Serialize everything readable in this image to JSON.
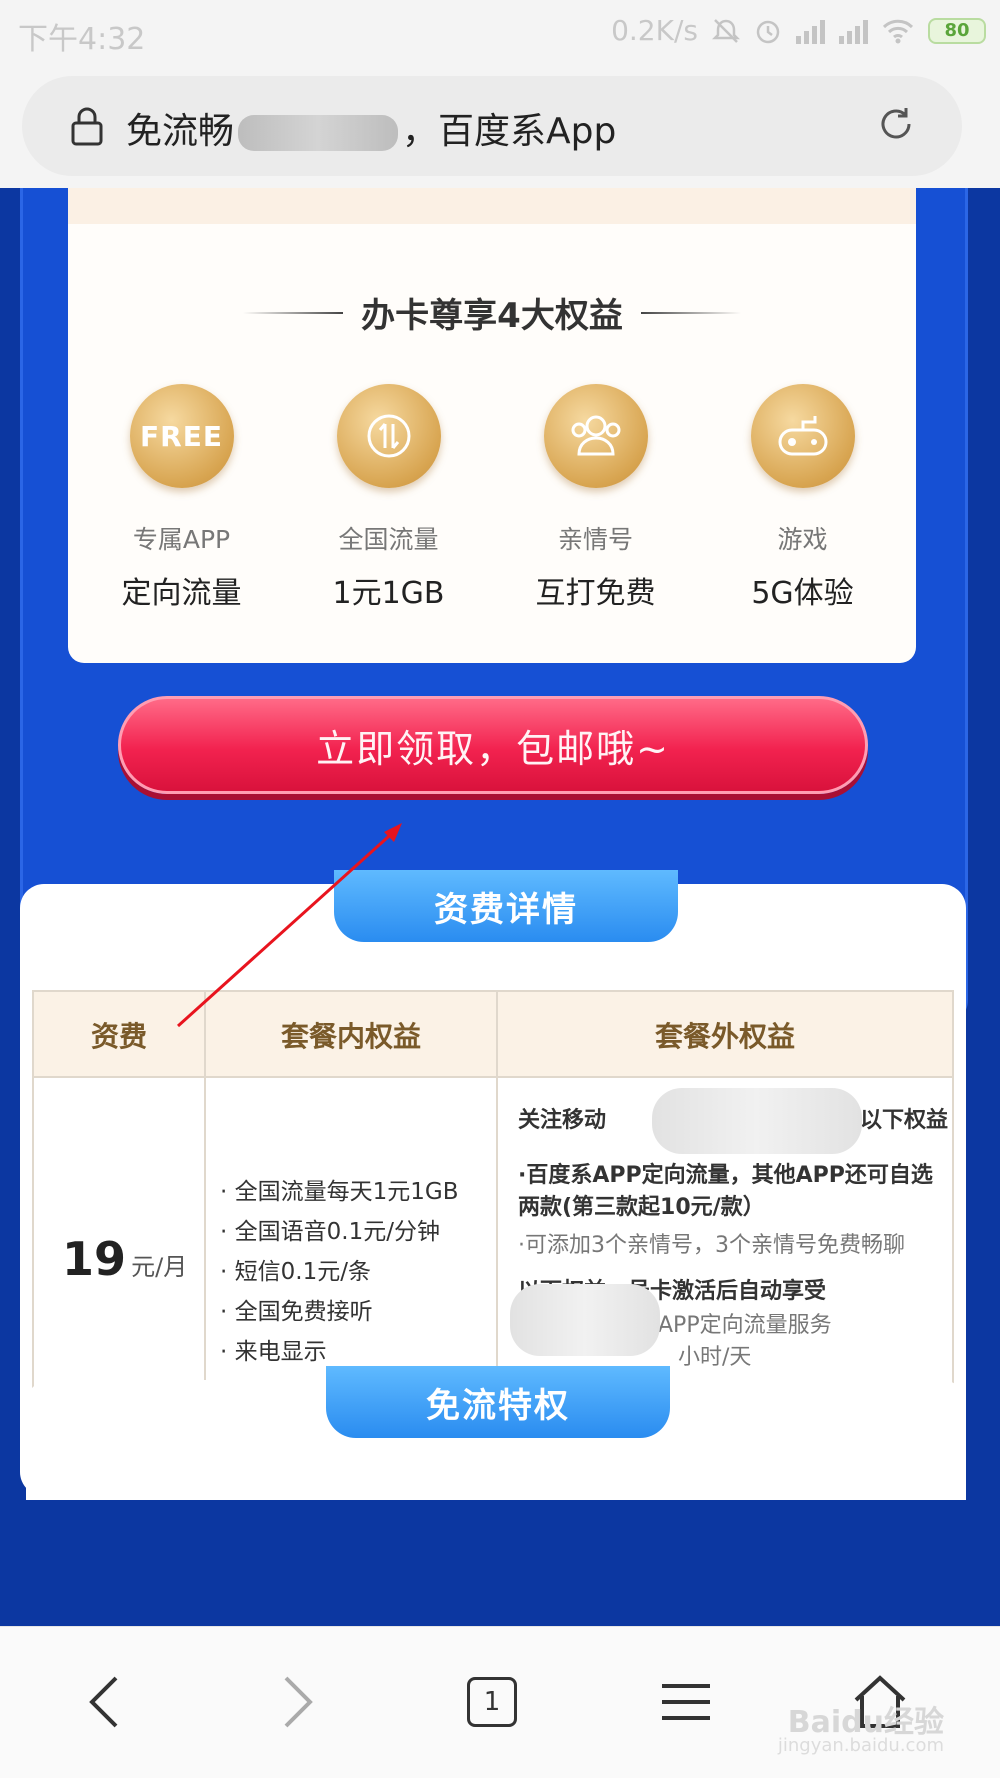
{
  "status_bar": {
    "time": "下午4:32",
    "speed": "0.2K/s",
    "battery": "80"
  },
  "url_bar": {
    "prefix": "免流畅",
    "suffix": "，百度系App"
  },
  "benefits_section": {
    "title": "办卡尊享4大权益",
    "items": [
      {
        "icon": "free-icon",
        "icon_text": "FREE",
        "label": "专属APP",
        "value": "定向流量"
      },
      {
        "icon": "data-icon",
        "label": "全国流量",
        "value": "1元1GB"
      },
      {
        "icon": "family-icon",
        "label": "亲情号",
        "value": "互打免费"
      },
      {
        "icon": "gamepad-icon",
        "label": "游戏",
        "value": "5G体验"
      }
    ]
  },
  "claim_button": "立即领取，包邮哦~",
  "fee_details": {
    "tab": "资费详情",
    "headers": [
      "资费",
      "套餐内权益",
      "套餐外权益"
    ],
    "price": "19",
    "price_unit": "元/月",
    "in_plan": [
      "全国流量每天1元1GB",
      "全国语音0.1元/分钟",
      "短信0.1元/条",
      "全国免费接听",
      "来电显示"
    ],
    "out_plan": {
      "intro_left": "关注移动",
      "intro_right": "以下权益",
      "item1": "·百度系APP定向流量，其他APP还可自选两款(第三款起10元/款）",
      "item2": "·可添加3个亲情号，3个亲情号免费畅聊",
      "subtitle": "以下权益，号卡激活后自动享受",
      "item3": "APP定向流量服务",
      "item4": "小时/天"
    }
  },
  "free_privilege_tab": "免流特权",
  "bottom_nav": {
    "tab_count": "1",
    "watermark": "Baidu经验",
    "watermark_sub": "jingyan.baidu.com"
  }
}
